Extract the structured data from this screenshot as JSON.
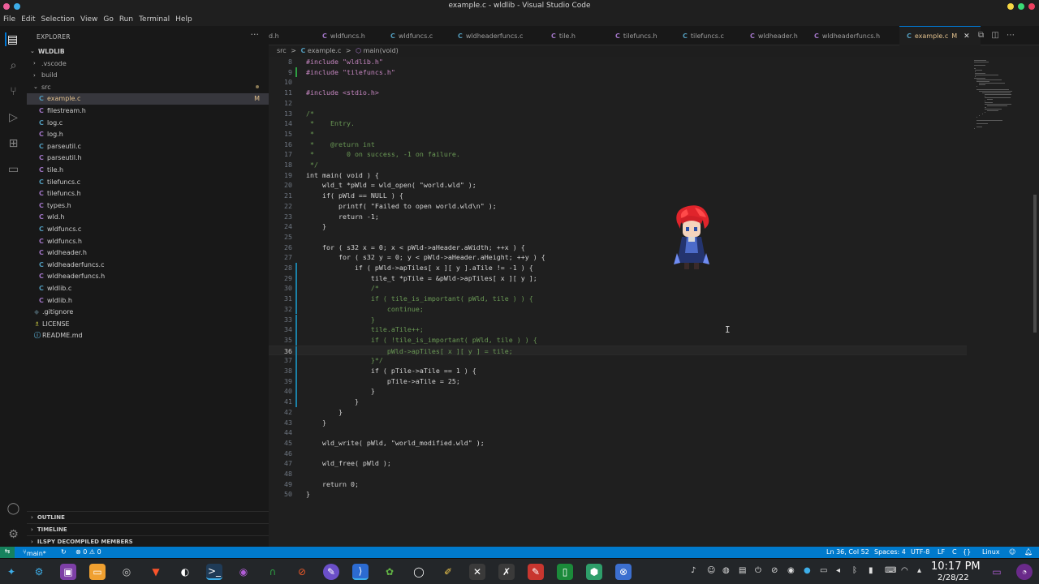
{
  "window": {
    "title": "example.c - wldlib - Visual Studio Code"
  },
  "menu": [
    "File",
    "Edit",
    "Selection",
    "View",
    "Go",
    "Run",
    "Terminal",
    "Help"
  ],
  "colors": {
    "accent": "#007acc",
    "statusbar": "#007acc",
    "active_tab_border": "#0078d4",
    "c_icon": "#519aba",
    "h_icon": "#a074c4",
    "modified": "#e2c08d"
  },
  "activity_icons": [
    "explorer-icon",
    "search-icon",
    "source-control-icon",
    "run-debug-icon",
    "extensions-icon",
    "remote-explorer-icon",
    "accounts-icon",
    "settings-gear-icon"
  ],
  "sidebar": {
    "title": "EXPLORER",
    "more": "···",
    "root": "WLDLIB",
    "items": [
      {
        "label": ".vscode",
        "kind": "folder",
        "collapsed": true
      },
      {
        "label": "build",
        "kind": "folder",
        "collapsed": true
      },
      {
        "label": "src",
        "kind": "folder",
        "collapsed": false
      },
      {
        "label": "example.c",
        "kind": "c",
        "badge": "M",
        "selected": true
      },
      {
        "label": "filestream.h",
        "kind": "h"
      },
      {
        "label": "log.c",
        "kind": "c"
      },
      {
        "label": "log.h",
        "kind": "h"
      },
      {
        "label": "parseutil.c",
        "kind": "c"
      },
      {
        "label": "parseutil.h",
        "kind": "h"
      },
      {
        "label": "tile.h",
        "kind": "h"
      },
      {
        "label": "tilefuncs.c",
        "kind": "c"
      },
      {
        "label": "tilefuncs.h",
        "kind": "h"
      },
      {
        "label": "types.h",
        "kind": "h"
      },
      {
        "label": "wld.h",
        "kind": "h"
      },
      {
        "label": "wldfuncs.c",
        "kind": "c"
      },
      {
        "label": "wldfuncs.h",
        "kind": "h"
      },
      {
        "label": "wldheader.h",
        "kind": "h"
      },
      {
        "label": "wldheaderfuncs.c",
        "kind": "c"
      },
      {
        "label": "wldheaderfuncs.h",
        "kind": "h"
      },
      {
        "label": "wldlib.c",
        "kind": "c"
      },
      {
        "label": "wldlib.h",
        "kind": "h"
      },
      {
        "label": ".gitignore",
        "kind": "git"
      },
      {
        "label": "LICENSE",
        "kind": "license"
      },
      {
        "label": "README.md",
        "kind": "md"
      }
    ],
    "sections": [
      "OUTLINE",
      "TIMELINE",
      "ILSPY DECOMPILED MEMBERS"
    ]
  },
  "tabs": [
    {
      "label": "d.h",
      "kind": "h"
    },
    {
      "label": "wldfuncs.h",
      "kind": "h"
    },
    {
      "label": "wldfuncs.c",
      "kind": "c"
    },
    {
      "label": "wldheaderfuncs.c",
      "kind": "c"
    },
    {
      "label": "tile.h",
      "kind": "h"
    },
    {
      "label": "tilefuncs.h",
      "kind": "h"
    },
    {
      "label": "tilefuncs.c",
      "kind": "c"
    },
    {
      "label": "wldheader.h",
      "kind": "h"
    },
    {
      "label": "wldheaderfuncs.h",
      "kind": "h"
    },
    {
      "label": "example.c",
      "kind": "c",
      "badge": "M",
      "active": true
    }
  ],
  "breadcrumb": {
    "folder": "src",
    "sep": ">",
    "file": "example.c",
    "symbol": "main(void)"
  },
  "code": [
    {
      "n": "8",
      "t": "#include \"wldlib.h\""
    },
    {
      "n": "9",
      "t": "#include \"tilefuncs.h\""
    },
    {
      "n": "10",
      "t": ""
    },
    {
      "n": "11",
      "t": "#include <stdio.h>"
    },
    {
      "n": "12",
      "t": ""
    },
    {
      "n": "13",
      "t": "/*"
    },
    {
      "n": "14",
      "t": " *    Entry."
    },
    {
      "n": "15",
      "t": " *"
    },
    {
      "n": "16",
      "t": " *    @return int"
    },
    {
      "n": "17",
      "t": " *        0 on success, -1 on failure."
    },
    {
      "n": "18",
      "t": " */"
    },
    {
      "n": "19",
      "t": "int main( void ) {"
    },
    {
      "n": "20",
      "t": "    wld_t *pWld = wld_open( \"world.wld\" );"
    },
    {
      "n": "21",
      "t": "    if( pWld == NULL ) {"
    },
    {
      "n": "22",
      "t": "        printf( \"Failed to open world.wld\\n\" );"
    },
    {
      "n": "23",
      "t": "        return -1;"
    },
    {
      "n": "24",
      "t": "    }"
    },
    {
      "n": "25",
      "t": ""
    },
    {
      "n": "26",
      "t": "    for ( s32 x = 0; x < pWld->aHeader.aWidth; ++x ) {"
    },
    {
      "n": "27",
      "t": "        for ( s32 y = 0; y < pWld->aHeader.aHeight; ++y ) {"
    },
    {
      "n": "28",
      "t": "            if ( pWld->apTiles[ x ][ y ].aTile != -1 ) {"
    },
    {
      "n": "29",
      "t": "                tile_t *pTile = &pWld->apTiles[ x ][ y ];"
    },
    {
      "n": "30",
      "t": "                /*"
    },
    {
      "n": "31",
      "t": "                if ( tile_is_important( pWld, tile ) ) {"
    },
    {
      "n": "32",
      "t": "                    continue;"
    },
    {
      "n": "33",
      "t": "                }"
    },
    {
      "n": "34",
      "t": "                tile.aTile++;"
    },
    {
      "n": "35",
      "t": "                if ( !tile_is_important( pWld, tile ) ) {"
    },
    {
      "n": "36",
      "t": "                    pWld->apTiles[ x ][ y ] = tile;"
    },
    {
      "n": "37",
      "t": "                }*/"
    },
    {
      "n": "38",
      "t": "                if ( pTile->aTile == 1 ) {"
    },
    {
      "n": "39",
      "t": "                    pTile->aTile = 25;"
    },
    {
      "n": "40",
      "t": "                }"
    },
    {
      "n": "41",
      "t": "            }"
    },
    {
      "n": "42",
      "t": "        }"
    },
    {
      "n": "43",
      "t": "    }"
    },
    {
      "n": "44",
      "t": ""
    },
    {
      "n": "45",
      "t": "    wld_write( pWld, \"world_modified.wld\" );"
    },
    {
      "n": "46",
      "t": ""
    },
    {
      "n": "47",
      "t": "    wld_free( pWld );"
    },
    {
      "n": "48",
      "t": ""
    },
    {
      "n": "49",
      "t": "    return 0;"
    },
    {
      "n": "50",
      "t": "}"
    }
  ],
  "current_line": "36",
  "status": {
    "branch": "main*",
    "errors": "⊗ 0 ⚠ 0",
    "position": "Ln 36, Col 52",
    "spaces": "Spaces: 4",
    "encoding": "UTF-8",
    "eol": "LF",
    "language": "C",
    "platform": "Linux"
  },
  "clock": {
    "time": "10:17 PM",
    "date": "2/28/22"
  }
}
